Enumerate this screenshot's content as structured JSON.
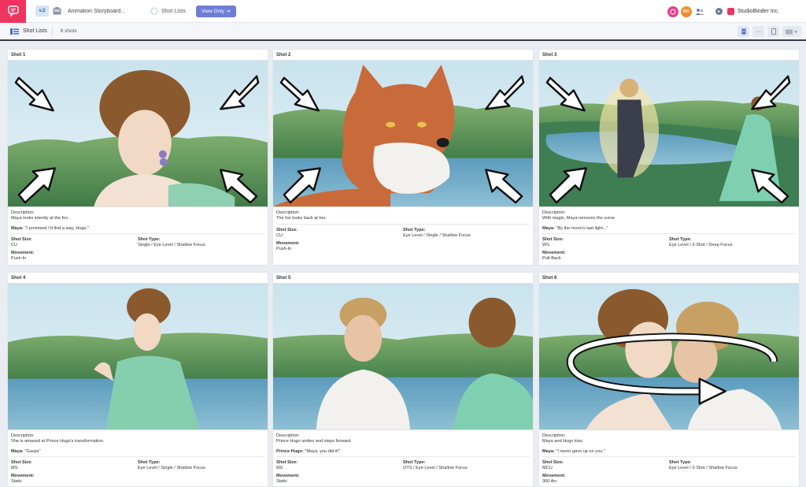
{
  "app": {
    "version": "v.2",
    "project_name": "Animation Storyboard...",
    "nav_shot_lists": "Shot Lists",
    "view_only": "View Only",
    "avatar_initials": "RO",
    "company": "StudioBinder Inc.",
    "brand_color": "#f0335f",
    "accent_color": "#6d7ed6"
  },
  "toolbar": {
    "title": "Shot Lists",
    "count": "6 shots",
    "more": "···"
  },
  "labels": {
    "description": "Description:",
    "shot_size": "Shot Size:",
    "shot_type": "Shot Type:",
    "movement": "Movement:"
  },
  "shots": [
    {
      "title": "Shot  1",
      "description": "Maya looks intently at the fox.",
      "speaker": "Maya:",
      "line": " \"I promised I'd find a way, Hugo.\"",
      "size": "CU",
      "type": "Single / Eye Level / Shallow Focus",
      "movement": "Push-In"
    },
    {
      "title": "Shot  2",
      "description": "The fox looks back at her.",
      "speaker": "",
      "line": "",
      "size": "CU",
      "type": "Eye Level / Single / Shallow Focus",
      "movement": "Push-In"
    },
    {
      "title": "Shot  3",
      "description": "With magic, Maya removes the curse",
      "speaker": "Maya:",
      "line": " \"By the moon's last light...\"",
      "size": "WS",
      "type": "Eye Level / 2-Shot / Deep Focus",
      "movement": "Pull-Back"
    },
    {
      "title": "Shot  4",
      "description": "She is amazed at Prince Hugo's transformation.",
      "speaker": "Maya:",
      "line": " \"Gasps\"",
      "size": "MS",
      "type": "Eye Level / Single / Shallow Focus",
      "movement": "Static"
    },
    {
      "title": "Shot  5",
      "description": "Prince Hugo smiles and steps forward.",
      "speaker": "Prince Hugo:",
      "line": " \"Maya, you did it!\"",
      "size": "MS",
      "type": "OTS / Eye Level / Shallow Focus",
      "movement": "Static"
    },
    {
      "title": "Shot  6",
      "description": "Maya and Hugo kiss.",
      "speaker": "Maya:",
      "line": " \"I never gave up on you.\"",
      "size": "MCU",
      "type": "Eye Level / 2-Shot / Shallow Focus",
      "movement": "360 Arc"
    }
  ]
}
